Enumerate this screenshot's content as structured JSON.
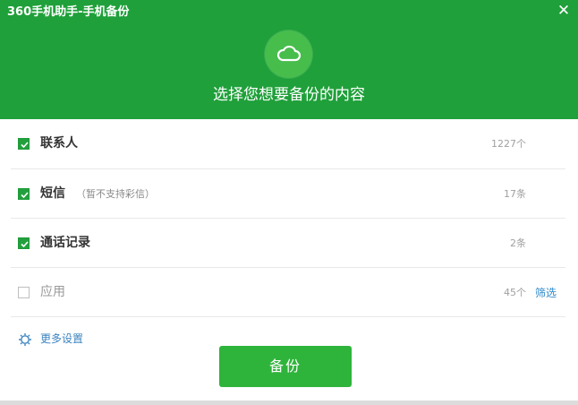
{
  "window": {
    "title": "360手机助手-手机备份",
    "close_glyph": "✕"
  },
  "header": {
    "icon": "cloud-icon",
    "subtitle": "选择您想要备份的内容"
  },
  "items": [
    {
      "label": "联系人",
      "note": "",
      "count": "1227个",
      "checked": true,
      "link": ""
    },
    {
      "label": "短信",
      "note": "（暂不支持彩信）",
      "count": "17条",
      "checked": true,
      "link": ""
    },
    {
      "label": "通话记录",
      "note": "",
      "count": "2条",
      "checked": true,
      "link": ""
    },
    {
      "label": "应用",
      "note": "",
      "count": "45个",
      "checked": false,
      "link": "筛选"
    }
  ],
  "footer": {
    "settings_label": "更多设置",
    "backup_label": "备份"
  },
  "colors": {
    "header_bg": "#1fa03a",
    "button_bg": "#2fb43b",
    "link": "#2d8ac9"
  }
}
